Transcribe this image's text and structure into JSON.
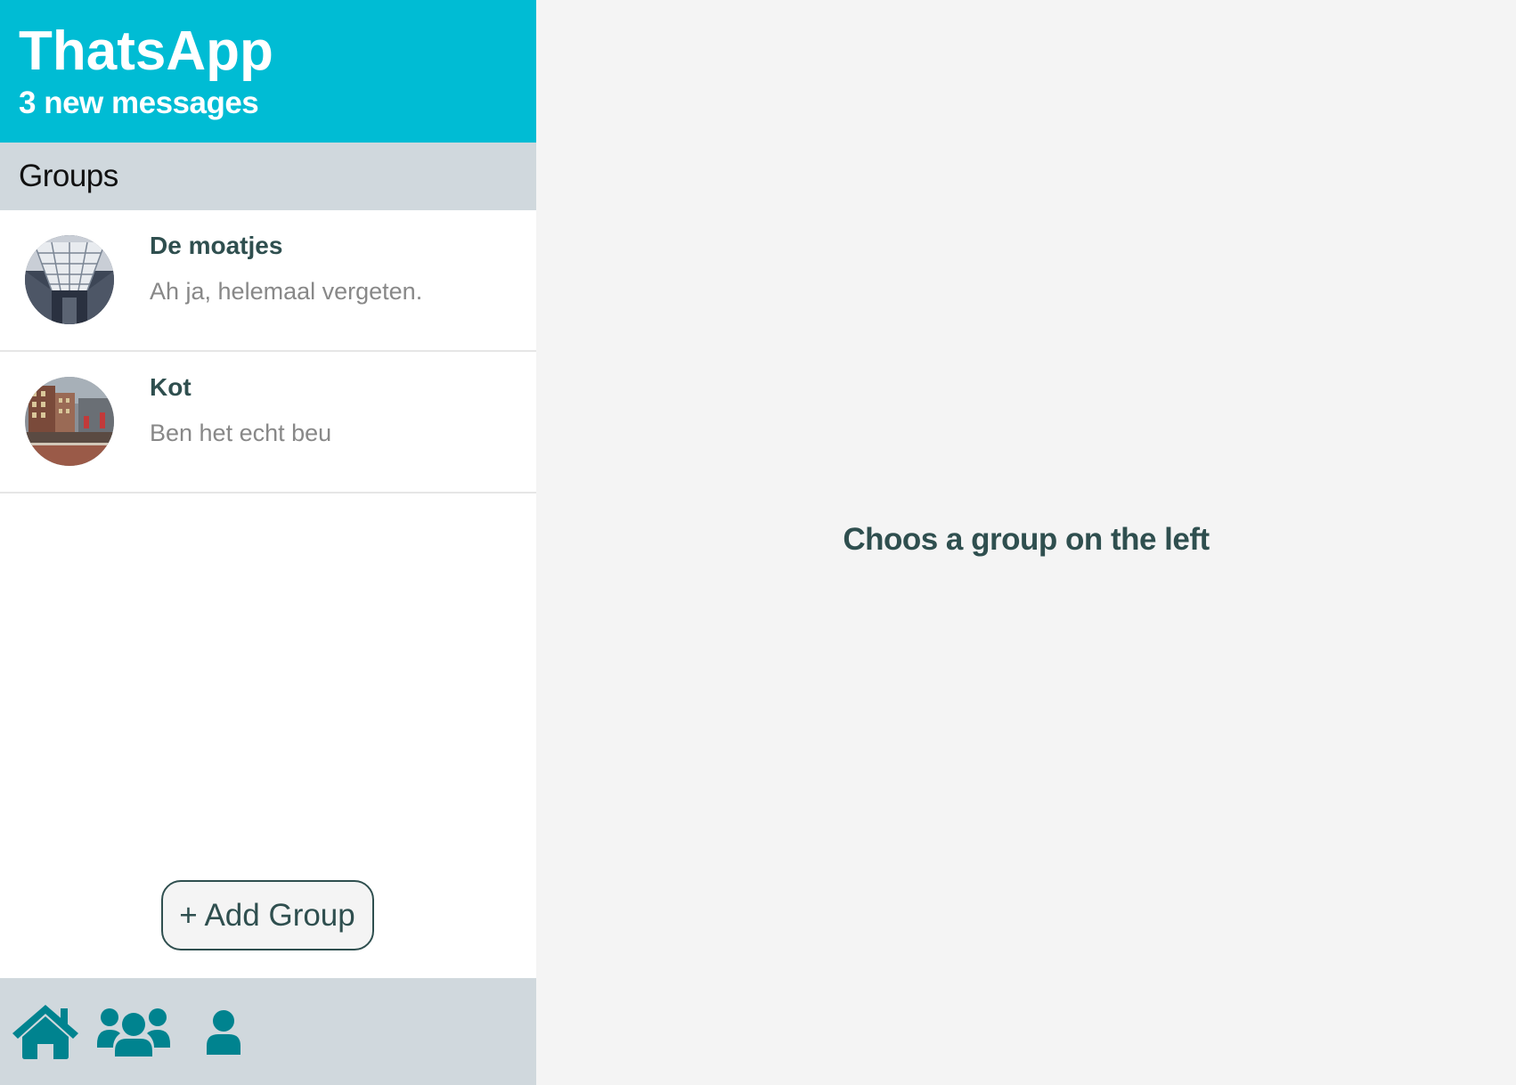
{
  "header": {
    "app_title": "ThatsApp",
    "new_messages": "3 new messages"
  },
  "sidebar": {
    "section_title": "Groups",
    "groups": [
      {
        "name": "De moatjes",
        "last_message": "Ah ja, helemaal vergeten.",
        "avatar": "glass-roof-hall-photo"
      },
      {
        "name": "Kot",
        "last_message": "Ben het echt beu",
        "avatar": "city-street-photo"
      }
    ],
    "add_group_label": "+ Add Group"
  },
  "bottom_nav": {
    "items": [
      {
        "icon": "home-icon"
      },
      {
        "icon": "users-icon"
      },
      {
        "icon": "user-icon"
      }
    ]
  },
  "main": {
    "placeholder": "Choos a group on the left"
  },
  "colors": {
    "header_bg": "#00bcd4",
    "section_bg": "#d0d8dd",
    "nav_icon": "#00838f",
    "text_dark": "#2f4f4f",
    "text_muted": "#888888",
    "main_bg": "#f4f4f4"
  }
}
